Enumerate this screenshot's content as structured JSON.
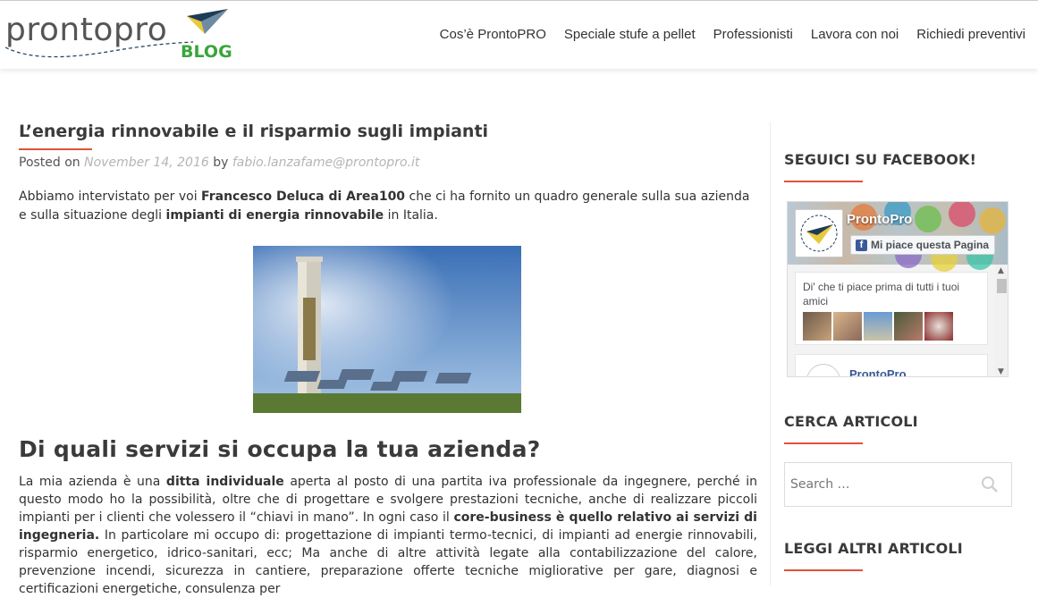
{
  "header": {
    "logo_word": "prontopro",
    "logo_blog": "BLOG",
    "nav": [
      {
        "label": "Cos’è ProntoPRO"
      },
      {
        "label": "Speciale stufe a pellet"
      },
      {
        "label": "Professionisti"
      },
      {
        "label": "Lavora con noi"
      },
      {
        "label": "Richiedi preventivi"
      }
    ]
  },
  "post": {
    "title": "L’energia rinnovabile e il risparmio sugli impianti",
    "meta_posted_on": "Posted on",
    "meta_date": "November 14, 2016",
    "meta_by": "by",
    "meta_author": "fabio.lanzafame@prontopro.it",
    "intro": {
      "p1": "Abbiamo intervistato per voi ",
      "b1": "Francesco Deluca di Area100",
      "p2": " che ci ha fornito un quadro generale sulla sua azienda e sulla situazione degli ",
      "b2": "impianti di energia rinnovabile",
      "p3": " in Italia."
    },
    "section_heading": "Di quali servizi si occupa la tua azienda?",
    "body": {
      "p1": "La mia azienda è una ",
      "b1": "ditta individuale",
      "p2": " aperta al posto di una partita iva professionale da ingegnere, perché in questo modo ho la possibilità, oltre che di progettare e svolgere prestazioni tecniche, anche di realizzare piccoli impianti per i clienti che volessero il “chiavi in mano”. In ogni caso il ",
      "b2": "core-business è quello relativo ai servizi di ingegneria.",
      "p3": " In particolare mi occupo di: progettazione di impianti termo-tecnici, di impianti ad energie rinnovabili, risparmio energetico, idrico-sanitari, ecc; Ma anche di altre attività legate alla contabilizzazione del calore, prevenzione incendi, sicurezza in cantiere, preparazione offerte tecniche migliorative per gare, diagnosi e certificazioni energetiche, consulenza per"
    }
  },
  "sidebar": {
    "facebook_title": "SEGUICI SU FACEBOOK!",
    "fb_page_name": "ProntoPro",
    "fb_like_label": "Mi piace questa Pagina",
    "fb_friends_text": "Di' che ti piace prima di tutti i tuoi amici",
    "fb_post_name": "ProntoPro",
    "search_title": "CERCA ARTICOLI",
    "search_placeholder": "Search …",
    "more_title": "LEGGI ALTRI ARTICOLI"
  },
  "colors": {
    "accent": "#e0523b",
    "brand_green": "#3aa53b",
    "facebook_blue": "#3b5998"
  }
}
